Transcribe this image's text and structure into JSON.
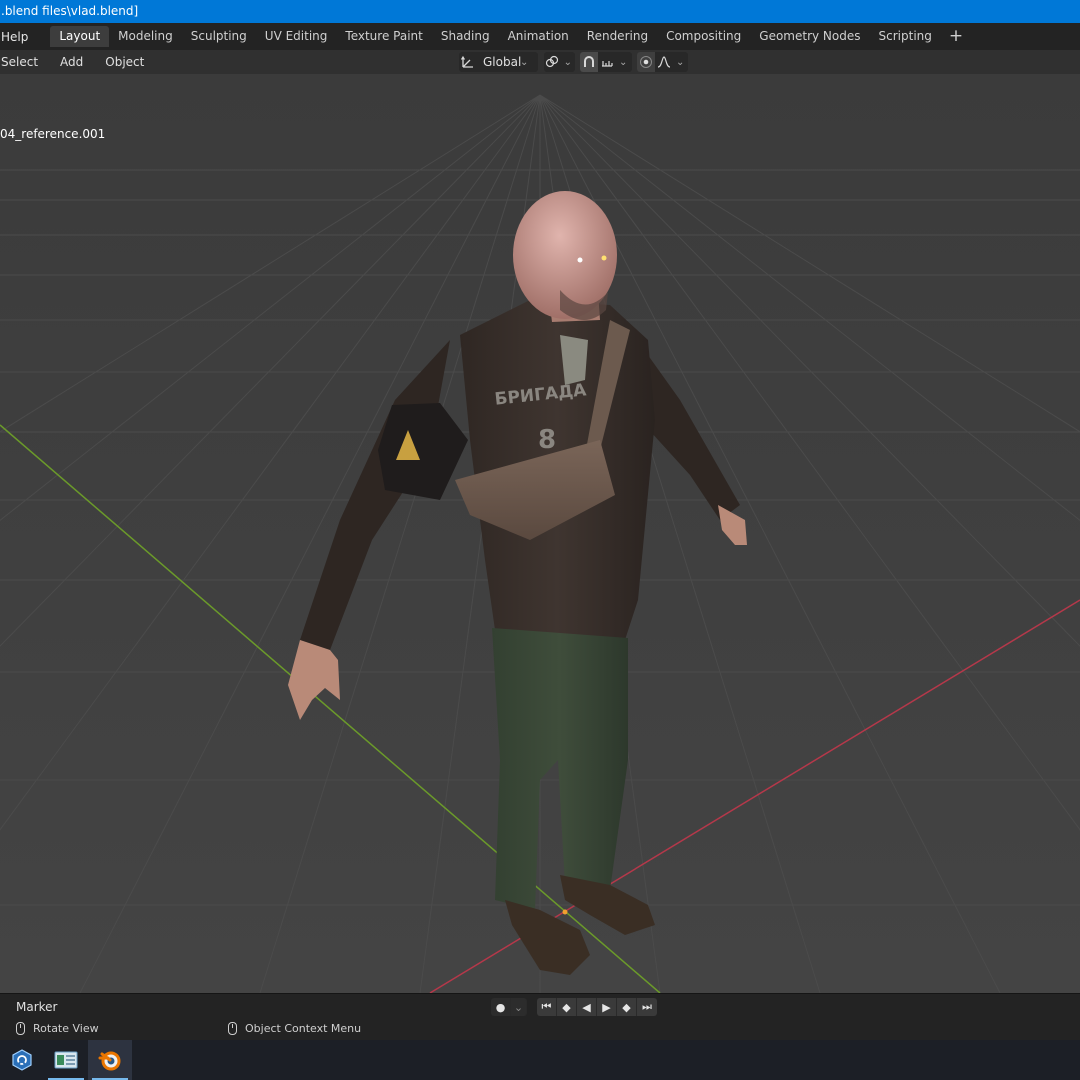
{
  "window": {
    "title": ".blend files\\vlad.blend]"
  },
  "topbar": {
    "help_label": "Help",
    "workspaces": [
      {
        "label": "Layout",
        "active": true
      },
      {
        "label": "Modeling",
        "active": false
      },
      {
        "label": "Sculpting",
        "active": false
      },
      {
        "label": "UV Editing",
        "active": false
      },
      {
        "label": "Texture Paint",
        "active": false
      },
      {
        "label": "Shading",
        "active": false
      },
      {
        "label": "Animation",
        "active": false
      },
      {
        "label": "Rendering",
        "active": false
      },
      {
        "label": "Compositing",
        "active": false
      },
      {
        "label": "Geometry Nodes",
        "active": false
      },
      {
        "label": "Scripting",
        "active": false
      }
    ],
    "add_workspace": "+"
  },
  "header": {
    "menus": [
      "Select",
      "Add",
      "Object"
    ],
    "transform_orientation": "Global"
  },
  "viewport": {
    "object_name": "04_reference.001",
    "character": {
      "chest_text": "БРИГАДА",
      "chest_number": "8"
    },
    "colors": {
      "background": "#3d3d3d",
      "grid": "#4a4a4a",
      "x_axis": "#b5384a",
      "y_axis": "#6b9a2a"
    }
  },
  "timeline": {
    "marker_label": "Marker"
  },
  "status": {
    "left_hint": "Rotate View",
    "middle_hint": "Object Context Menu"
  },
  "taskbar": {
    "apps": [
      "sync-app-icon",
      "explorer-app-icon",
      "blender-app-icon"
    ]
  }
}
